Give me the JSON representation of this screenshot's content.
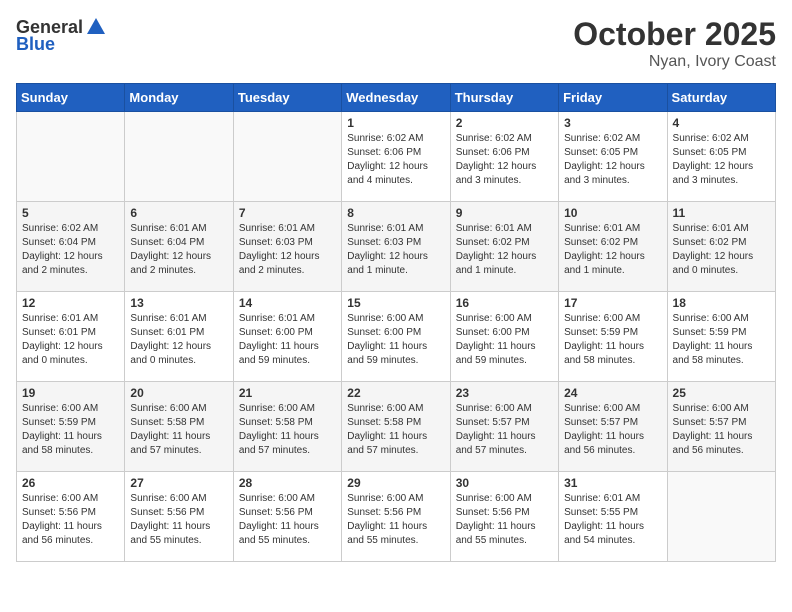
{
  "header": {
    "logo_general": "General",
    "logo_blue": "Blue",
    "title": "October 2025",
    "subtitle": "Nyan, Ivory Coast"
  },
  "weekdays": [
    "Sunday",
    "Monday",
    "Tuesday",
    "Wednesday",
    "Thursday",
    "Friday",
    "Saturday"
  ],
  "weeks": [
    [
      {
        "day": "",
        "info": ""
      },
      {
        "day": "",
        "info": ""
      },
      {
        "day": "",
        "info": ""
      },
      {
        "day": "1",
        "info": "Sunrise: 6:02 AM\nSunset: 6:06 PM\nDaylight: 12 hours\nand 4 minutes."
      },
      {
        "day": "2",
        "info": "Sunrise: 6:02 AM\nSunset: 6:06 PM\nDaylight: 12 hours\nand 3 minutes."
      },
      {
        "day": "3",
        "info": "Sunrise: 6:02 AM\nSunset: 6:05 PM\nDaylight: 12 hours\nand 3 minutes."
      },
      {
        "day": "4",
        "info": "Sunrise: 6:02 AM\nSunset: 6:05 PM\nDaylight: 12 hours\nand 3 minutes."
      }
    ],
    [
      {
        "day": "5",
        "info": "Sunrise: 6:02 AM\nSunset: 6:04 PM\nDaylight: 12 hours\nand 2 minutes."
      },
      {
        "day": "6",
        "info": "Sunrise: 6:01 AM\nSunset: 6:04 PM\nDaylight: 12 hours\nand 2 minutes."
      },
      {
        "day": "7",
        "info": "Sunrise: 6:01 AM\nSunset: 6:03 PM\nDaylight: 12 hours\nand 2 minutes."
      },
      {
        "day": "8",
        "info": "Sunrise: 6:01 AM\nSunset: 6:03 PM\nDaylight: 12 hours\nand 1 minute."
      },
      {
        "day": "9",
        "info": "Sunrise: 6:01 AM\nSunset: 6:02 PM\nDaylight: 12 hours\nand 1 minute."
      },
      {
        "day": "10",
        "info": "Sunrise: 6:01 AM\nSunset: 6:02 PM\nDaylight: 12 hours\nand 1 minute."
      },
      {
        "day": "11",
        "info": "Sunrise: 6:01 AM\nSunset: 6:02 PM\nDaylight: 12 hours\nand 0 minutes."
      }
    ],
    [
      {
        "day": "12",
        "info": "Sunrise: 6:01 AM\nSunset: 6:01 PM\nDaylight: 12 hours\nand 0 minutes."
      },
      {
        "day": "13",
        "info": "Sunrise: 6:01 AM\nSunset: 6:01 PM\nDaylight: 12 hours\nand 0 minutes."
      },
      {
        "day": "14",
        "info": "Sunrise: 6:01 AM\nSunset: 6:00 PM\nDaylight: 11 hours\nand 59 minutes."
      },
      {
        "day": "15",
        "info": "Sunrise: 6:00 AM\nSunset: 6:00 PM\nDaylight: 11 hours\nand 59 minutes."
      },
      {
        "day": "16",
        "info": "Sunrise: 6:00 AM\nSunset: 6:00 PM\nDaylight: 11 hours\nand 59 minutes."
      },
      {
        "day": "17",
        "info": "Sunrise: 6:00 AM\nSunset: 5:59 PM\nDaylight: 11 hours\nand 58 minutes."
      },
      {
        "day": "18",
        "info": "Sunrise: 6:00 AM\nSunset: 5:59 PM\nDaylight: 11 hours\nand 58 minutes."
      }
    ],
    [
      {
        "day": "19",
        "info": "Sunrise: 6:00 AM\nSunset: 5:59 PM\nDaylight: 11 hours\nand 58 minutes."
      },
      {
        "day": "20",
        "info": "Sunrise: 6:00 AM\nSunset: 5:58 PM\nDaylight: 11 hours\nand 57 minutes."
      },
      {
        "day": "21",
        "info": "Sunrise: 6:00 AM\nSunset: 5:58 PM\nDaylight: 11 hours\nand 57 minutes."
      },
      {
        "day": "22",
        "info": "Sunrise: 6:00 AM\nSunset: 5:58 PM\nDaylight: 11 hours\nand 57 minutes."
      },
      {
        "day": "23",
        "info": "Sunrise: 6:00 AM\nSunset: 5:57 PM\nDaylight: 11 hours\nand 57 minutes."
      },
      {
        "day": "24",
        "info": "Sunrise: 6:00 AM\nSunset: 5:57 PM\nDaylight: 11 hours\nand 56 minutes."
      },
      {
        "day": "25",
        "info": "Sunrise: 6:00 AM\nSunset: 5:57 PM\nDaylight: 11 hours\nand 56 minutes."
      }
    ],
    [
      {
        "day": "26",
        "info": "Sunrise: 6:00 AM\nSunset: 5:56 PM\nDaylight: 11 hours\nand 56 minutes."
      },
      {
        "day": "27",
        "info": "Sunrise: 6:00 AM\nSunset: 5:56 PM\nDaylight: 11 hours\nand 55 minutes."
      },
      {
        "day": "28",
        "info": "Sunrise: 6:00 AM\nSunset: 5:56 PM\nDaylight: 11 hours\nand 55 minutes."
      },
      {
        "day": "29",
        "info": "Sunrise: 6:00 AM\nSunset: 5:56 PM\nDaylight: 11 hours\nand 55 minutes."
      },
      {
        "day": "30",
        "info": "Sunrise: 6:00 AM\nSunset: 5:56 PM\nDaylight: 11 hours\nand 55 minutes."
      },
      {
        "day": "31",
        "info": "Sunrise: 6:01 AM\nSunset: 5:55 PM\nDaylight: 11 hours\nand 54 minutes."
      },
      {
        "day": "",
        "info": ""
      }
    ]
  ]
}
